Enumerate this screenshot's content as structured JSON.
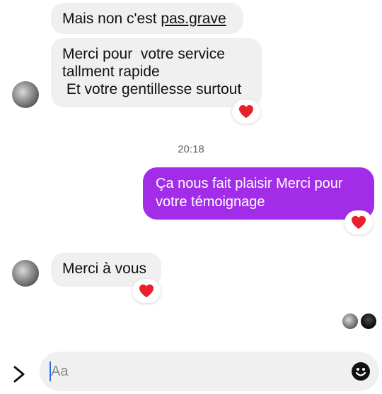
{
  "messages": [
    {
      "sender": "them",
      "lines": [
        "Mais non c'est pas.grave"
      ]
    },
    {
      "sender": "them",
      "lines": [
        "Merci pour  votre service",
        "tallment rapide",
        " Et votre gentillesse surtout"
      ],
      "reaction": "heart"
    },
    {
      "sender": "me",
      "lines": [
        "Ça nous fait plaisir Merci pour",
        "votre témoignage"
      ],
      "reaction": "heart"
    },
    {
      "sender": "them",
      "lines": [
        "Merci à vous"
      ],
      "reaction": "heart"
    }
  ],
  "first_message": {
    "before": "Mais non c'est ",
    "underlined": "pas.grave"
  },
  "timestamp": "20:18",
  "composer": {
    "placeholder": "Aa"
  },
  "icons": {
    "expand": "chevron-right-icon",
    "emoji": "emoji-icon",
    "reaction": "heart-icon"
  },
  "colors": {
    "outgoing_bubble": "#a32ce8",
    "incoming_bubble": "#f0f0f0",
    "heart": "#e8202a"
  }
}
